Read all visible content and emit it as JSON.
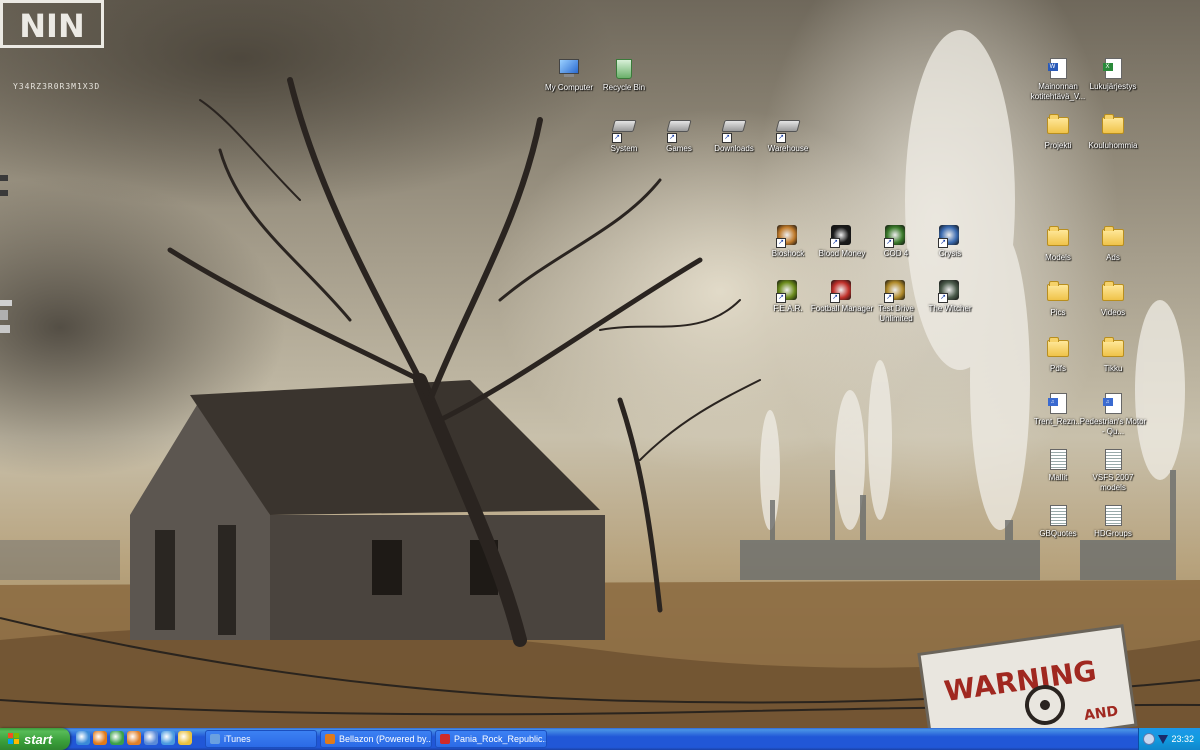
{
  "wallpaper": {
    "logo_text": "NIN",
    "logo_subtext": "Y34RZ3R0R3M1X3D",
    "sign_text": "WARNING",
    "sign_partial_text": "AND"
  },
  "desktop_icons": [
    {
      "label": "My Computer",
      "kind": "computer"
    },
    {
      "label": "Recycle Bin",
      "kind": "recycle"
    },
    {
      "label": "System",
      "kind": "drive"
    },
    {
      "label": "Games",
      "kind": "drive"
    },
    {
      "label": "Downloads",
      "kind": "drive"
    },
    {
      "label": "Warehouse",
      "kind": "drive"
    },
    {
      "label": "Mainonnan kotitehtävä_V...",
      "kind": "word"
    },
    {
      "label": "Lukujärjestys",
      "kind": "excel"
    },
    {
      "label": "Projekti",
      "kind": "folder"
    },
    {
      "label": "Kouluhommia",
      "kind": "folder"
    },
    {
      "label": "Bioshock",
      "kind": "game",
      "color": "#c07a2a"
    },
    {
      "label": "Blood Money",
      "kind": "game",
      "color": "#1a1a1a"
    },
    {
      "label": "COD 4",
      "kind": "game",
      "color": "#3a7a2a"
    },
    {
      "label": "Crysis",
      "kind": "game",
      "color": "#3a6ab0"
    },
    {
      "label": "Models",
      "kind": "folder"
    },
    {
      "label": "Ads",
      "kind": "folder"
    },
    {
      "label": "F.E.A.R.",
      "kind": "game",
      "color": "#6a8a1a"
    },
    {
      "label": "Football Manager",
      "kind": "game",
      "color": "#c0302a"
    },
    {
      "label": "Test Drive Unlimited",
      "kind": "game",
      "color": "#b08a2a"
    },
    {
      "label": "The Witcher",
      "kind": "game",
      "color": "#4a5a4a"
    },
    {
      "label": "Pics",
      "kind": "folder"
    },
    {
      "label": "Videos",
      "kind": "folder"
    },
    {
      "label": "Pdfs",
      "kind": "folder"
    },
    {
      "label": "Tikku",
      "kind": "folder"
    },
    {
      "label": "Trent_Rezn...",
      "kind": "mp3"
    },
    {
      "label": "Pedestrian's Motor - Qu...",
      "kind": "mp3"
    },
    {
      "label": "Mallit",
      "kind": "text"
    },
    {
      "label": "VSFS 2007 models",
      "kind": "text"
    },
    {
      "label": "GBQuotes",
      "kind": "text"
    },
    {
      "label": "HDGroups",
      "kind": "text"
    }
  ],
  "taskbar": {
    "start_label": "start",
    "quicklaunch": [
      {
        "icon": "show-desktop-icon",
        "color": "#3a8ad8"
      },
      {
        "icon": "firefox-icon",
        "color": "#e07a1a"
      },
      {
        "icon": "network-icon",
        "color": "#3aa04a"
      },
      {
        "icon": "media-icon",
        "color": "#e0802a"
      },
      {
        "icon": "itunes-icon",
        "color": "#5a8ad8"
      },
      {
        "icon": "window-icon",
        "color": "#4a9ae0"
      },
      {
        "icon": "explorer-icon",
        "color": "#e8c040"
      }
    ],
    "tasks": [
      {
        "label": "iTunes",
        "icon": "itunes-icon",
        "color": "#6aa0e0"
      },
      {
        "label": "Bellazon (Powered by...",
        "icon": "firefox-icon",
        "color": "#e07a1a"
      },
      {
        "label": "Pania_Rock_Republic...",
        "icon": "image-viewer-icon",
        "color": "#d02a2a"
      }
    ],
    "tray": {
      "clock": "23:32"
    }
  }
}
